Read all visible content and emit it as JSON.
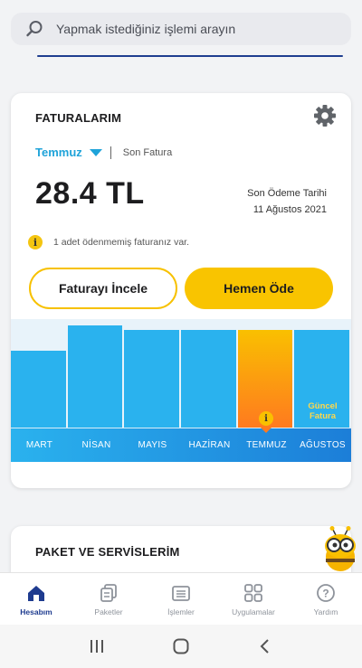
{
  "search": {
    "placeholder": "Yapmak istediğiniz işlemi arayın",
    "icon": "search-icon"
  },
  "bills": {
    "title": "FATURALARIM",
    "selected_month": "Temmuz",
    "bill_label": "Son Fatura",
    "amount": "28.4 TL",
    "due_label": "Son Ödeme Tarihi",
    "due_date": "11 Ağustos 2021",
    "notice": "1 adet ödenmemiş faturanız var.",
    "review_button": "Faturayı İncele",
    "pay_button": "Hemen Öde"
  },
  "chart_data": {
    "type": "bar",
    "categories": [
      "MART",
      "NİSAN",
      "MAYIS",
      "HAZİRAN",
      "TEMMUZ",
      "AĞUSTOS"
    ],
    "values": [
      0.71,
      0.94,
      0.9,
      0.9,
      0.9,
      0.9
    ],
    "highlighted": "TEMMUZ",
    "current_label_line1": "Güncel",
    "current_label_line2": "Fatura",
    "colors": {
      "bar": "#2ab2ee",
      "highlight_top": "#f9c000",
      "highlight_bottom": "#ff7a1f"
    }
  },
  "packages": {
    "title": "PAKET VE SERVİSLERİM"
  },
  "tabs": [
    {
      "label": "Hesabım",
      "icon": "home-icon",
      "active": true
    },
    {
      "label": "Paketler",
      "icon": "packages-icon",
      "active": false
    },
    {
      "label": "İşlemler",
      "icon": "list-icon",
      "active": false
    },
    {
      "label": "Uygulamalar",
      "icon": "apps-grid-icon",
      "active": false
    },
    {
      "label": "Yardım",
      "icon": "help-icon",
      "active": false
    }
  ],
  "colors": {
    "accent_blue": "#1fa3d9",
    "brand_navy": "#1e3b8f",
    "yellow": "#f9c400"
  }
}
